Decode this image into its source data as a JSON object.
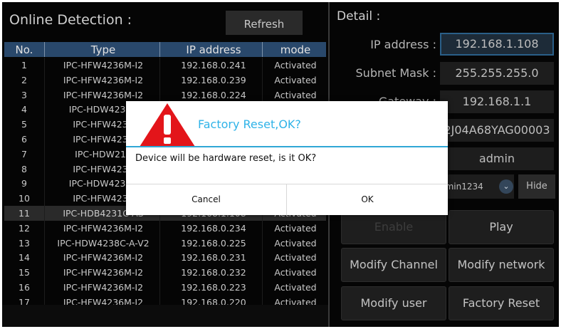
{
  "left_panel": {
    "title": "Online Detection :",
    "refresh_label": "Refresh",
    "columns": [
      "No.",
      "Type",
      "IP address",
      "mode"
    ],
    "rows": [
      {
        "no": "1",
        "type": "IPC-HFW4236M-I2",
        "ip": "192.168.0.241",
        "mode": "Activated"
      },
      {
        "no": "2",
        "type": "IPC-HFW4236M-I2",
        "ip": "192.168.0.239",
        "mode": "Activated"
      },
      {
        "no": "3",
        "type": "IPC-HFW4236M-I2",
        "ip": "192.168.0.224",
        "mode": "Activated"
      },
      {
        "no": "4",
        "type": "IPC-HDW4238C",
        "ip": "",
        "mode": ""
      },
      {
        "no": "5",
        "type": "IPC-HFW4236",
        "ip": "",
        "mode": ""
      },
      {
        "no": "6",
        "type": "IPC-HFW4236",
        "ip": "",
        "mode": ""
      },
      {
        "no": "7",
        "type": "IPC-HDW212",
        "ip": "",
        "mode": ""
      },
      {
        "no": "8",
        "type": "IPC-HFW4236",
        "ip": "",
        "mode": ""
      },
      {
        "no": "9",
        "type": "IPC-HDW4238C",
        "ip": "",
        "mode": ""
      },
      {
        "no": "10",
        "type": "IPC-HFW4236",
        "ip": "",
        "mode": ""
      },
      {
        "no": "11",
        "type": "IPC-HDB4231C-AS",
        "ip": "192.168.1.108",
        "mode": "Activated",
        "selected": true
      },
      {
        "no": "12",
        "type": "IPC-HFW4236M-I2",
        "ip": "192.168.0.234",
        "mode": "Activated"
      },
      {
        "no": "13",
        "type": "IPC-HDW4238C-A-V2",
        "ip": "192.168.0.225",
        "mode": "Activated"
      },
      {
        "no": "14",
        "type": "IPC-HFW4236M-I2",
        "ip": "192.168.0.231",
        "mode": "Activated"
      },
      {
        "no": "15",
        "type": "IPC-HFW4236M-I2",
        "ip": "192.168.0.232",
        "mode": "Activated"
      },
      {
        "no": "16",
        "type": "IPC-HFW4236M-I2",
        "ip": "192.168.0.223",
        "mode": "Activated"
      },
      {
        "no": "17",
        "type": "IPC-HFW4236M-I2",
        "ip": "192.168.0.220",
        "mode": "Activated"
      }
    ]
  },
  "detail": {
    "title": "Detail :",
    "ip_label": "IP address :",
    "ip_value": "192.168.1.108",
    "mask_label": "Subnet Mask :",
    "mask_value": "255.255.255.0",
    "gateway_label": "Gateway :",
    "gateway_value": "192.168.1.1",
    "serial_value": "2J04A68YAG00003",
    "user_value": "admin",
    "password_value": "dmin1234",
    "hide_label": "Hide"
  },
  "actions": {
    "enable": "Enable",
    "play": "Play",
    "modify_channel": "Modify Channel",
    "modify_network": "Modify network",
    "modify_user": "Modify user",
    "factory_reset": "Factory Reset"
  },
  "dialog": {
    "title": "Factory Reset,OK?",
    "message": "Device will be hardware reset, is it OK?",
    "cancel": "Cancel",
    "ok": "OK"
  },
  "colors": {
    "header_bg": "#29486b",
    "dialog_accent": "#30a7d6",
    "warning_red": "#e3151a"
  },
  "icons": {
    "warning": "warning-triangle-icon",
    "password_dropdown": "chevron-down-icon"
  }
}
